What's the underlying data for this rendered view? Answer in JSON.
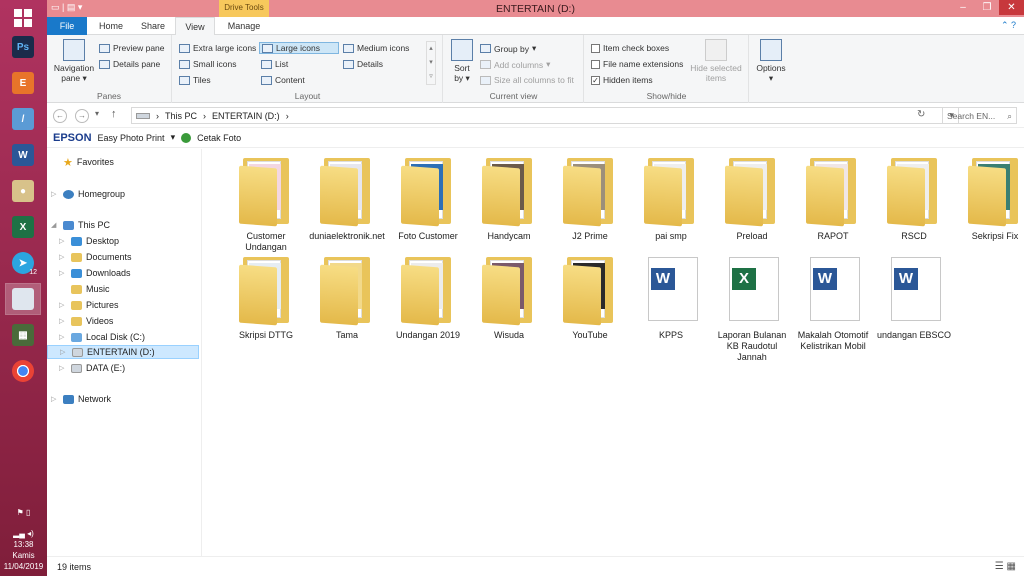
{
  "window": {
    "title": "ENTERTAIN (D:)",
    "context_tab": "Drive Tools"
  },
  "tabs": [
    "File",
    "Home",
    "Share",
    "View",
    "Manage"
  ],
  "ribbon": {
    "panes": {
      "label": "Panes",
      "navigation_pane": "Navigation",
      "navigation_pane2": "pane",
      "preview_pane": "Preview pane",
      "details_pane": "Details pane"
    },
    "layout": {
      "label": "Layout",
      "extra_large": "Extra large icons",
      "large": "Large icons",
      "medium": "Medium icons",
      "small": "Small icons",
      "list": "List",
      "details": "Details",
      "tiles": "Tiles",
      "content": "Content"
    },
    "current_view": {
      "label": "Current view",
      "sort_by": "Sort",
      "sort_by2": "by",
      "group_by": "Group by",
      "add_columns": "Add columns",
      "size_columns": "Size all columns to fit"
    },
    "show_hide": {
      "label": "Show/hide",
      "item_check_boxes": "Item check boxes",
      "file_name_extensions": "File name extensions",
      "hidden_items": "Hidden items",
      "hide_selected": "Hide selected",
      "hide_selected2": "items"
    },
    "options": "Options"
  },
  "address": {
    "crumbs": [
      "This PC",
      "ENTERTAIN (D:)"
    ],
    "search_placeholder": "Search EN..."
  },
  "epson": {
    "logo": "EPSON",
    "easy_photo_print": "Easy Photo Print",
    "cetak_foto": "Cetak Foto"
  },
  "nav": {
    "favorites": "Favorites",
    "homegroup": "Homegroup",
    "this_pc": "This PC",
    "desktop": "Desktop",
    "documents": "Documents",
    "downloads": "Downloads",
    "music": "Music",
    "pictures": "Pictures",
    "videos": "Videos",
    "local_disk": "Local Disk (C:)",
    "entertain": "ENTERTAIN (D:)",
    "data": "DATA (E:)",
    "network": "Network"
  },
  "items": [
    {
      "name": "Customer Undangan",
      "kind": "folder",
      "photo": "#f3d7e2"
    },
    {
      "name": "duniaelektronik.net",
      "kind": "folder",
      "photo": "#e6e6ee"
    },
    {
      "name": "Foto Customer",
      "kind": "folder",
      "photo": "#2c6fb6"
    },
    {
      "name": "Handycam",
      "kind": "folder",
      "photo": "#6b5a4a"
    },
    {
      "name": "J2 Prime",
      "kind": "folder",
      "photo": "#9c8f7a"
    },
    {
      "name": "pai smp",
      "kind": "folder",
      "photo": "#eee"
    },
    {
      "name": "Preload",
      "kind": "folder",
      "photo": "#eee"
    },
    {
      "name": "RAPOT",
      "kind": "folder",
      "photo": "#f0e6e6"
    },
    {
      "name": "RSCD",
      "kind": "folder",
      "photo": "#eee"
    },
    {
      "name": "Sekripsi Fix",
      "kind": "folder",
      "photo": "#3a7f72"
    },
    {
      "name": "Skripsi DTTG",
      "kind": "folder",
      "photo": "#e6edf2"
    },
    {
      "name": "Tama",
      "kind": "folder",
      "photo": "#f2d98a"
    },
    {
      "name": "Undangan 2019",
      "kind": "folder",
      "photo": "#ececec"
    },
    {
      "name": "Wisuda",
      "kind": "folder",
      "photo": "#7a5a6a"
    },
    {
      "name": "YouTube",
      "kind": "folder",
      "photo": "#2a2a2a"
    },
    {
      "name": "KPPS",
      "kind": "word"
    },
    {
      "name": "Laporan Bulanan KB Raudotul Jannah",
      "kind": "excel"
    },
    {
      "name": "Makalah Otomotif Kelistrikan Mobil",
      "kind": "word"
    },
    {
      "name": "undangan EBSCO",
      "kind": "word"
    }
  ],
  "status": {
    "count": "19 items"
  },
  "tray": {
    "time": "13:38",
    "day": "Kamis",
    "date": "11/04/2019",
    "badge": "12"
  }
}
